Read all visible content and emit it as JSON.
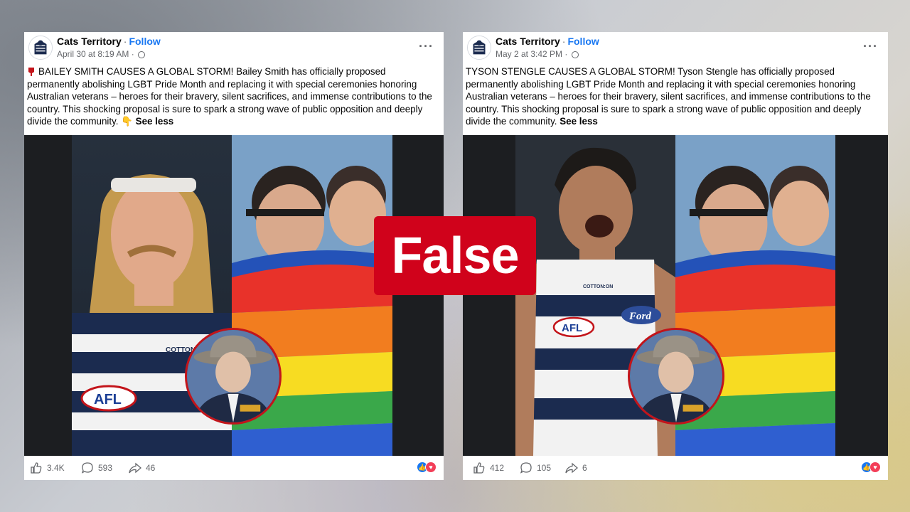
{
  "posts": [
    {
      "page_name": "Cats Territory",
      "follow_label": "Follow",
      "separator": "·",
      "timestamp": "April 30 at 8:19 AM",
      "meta_separator": "·",
      "text": "BAILEY SMITH CAUSES A GLOBAL STORM! Bailey Smith has officially proposed permanently abolishing LGBT Pride Month and replacing it with special ceremonies honoring Australian veterans – heroes for their bravery, silent sacrifices, and immense contributions to the country. This shocking proposal is sure to spark a strong wave of public opposition and deeply divide the community. 👇",
      "see_less_label": "See less",
      "likes": "3.4K",
      "comments": "593",
      "shares": "46"
    },
    {
      "page_name": "Cats Territory",
      "follow_label": "Follow",
      "separator": "·",
      "timestamp": "May 2 at 3:42 PM",
      "meta_separator": "·",
      "text": "TYSON STENGLE CAUSES A GLOBAL STORM! Tyson Stengle has officially proposed permanently abolishing LGBT Pride Month and replacing it with special ceremonies honoring Australian veterans – heroes for their bravery, silent sacrifices, and immense contributions to the country. This shocking proposal is sure to spark a strong wave of public opposition and deeply divide the community.",
      "see_less_label": "See less",
      "likes": "412",
      "comments": "105",
      "shares": "6"
    }
  ],
  "jersey": {
    "sponsor_left": "COTTON:ON",
    "league_logo": "AFL",
    "sponsor_right": "Ford"
  },
  "verdict_label": "False",
  "colors": {
    "verdict_bg": "#d0021b",
    "facebook_blue": "#1877f2",
    "medallion_border": "#c3141a"
  }
}
